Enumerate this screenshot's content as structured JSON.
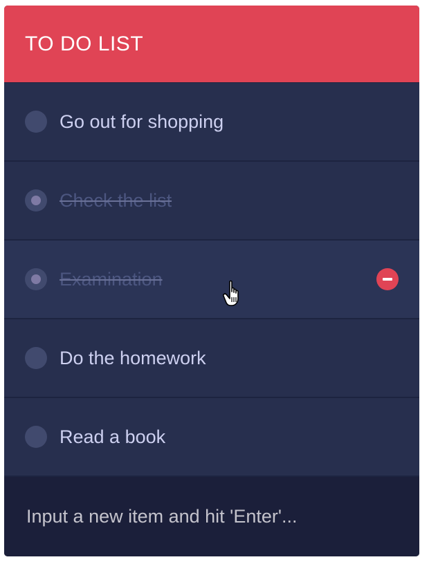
{
  "header": {
    "title": "TO DO LIST"
  },
  "items": [
    {
      "label": "Go out for shopping",
      "done": false
    },
    {
      "label": "Check the list",
      "done": true
    },
    {
      "label": "Examination",
      "done": true,
      "hovered": true,
      "remove_icon": "minus-circle-icon"
    },
    {
      "label": "Do the homework",
      "done": false
    },
    {
      "label": "Read a book",
      "done": false
    }
  ],
  "new_item": {
    "value": "",
    "placeholder": "Input a new item and hit 'Enter'..."
  },
  "colors": {
    "header": "#e04455",
    "list_bg": "#272f4e",
    "footer_bg": "#1b1f3a",
    "remove_button": "#e04455"
  }
}
